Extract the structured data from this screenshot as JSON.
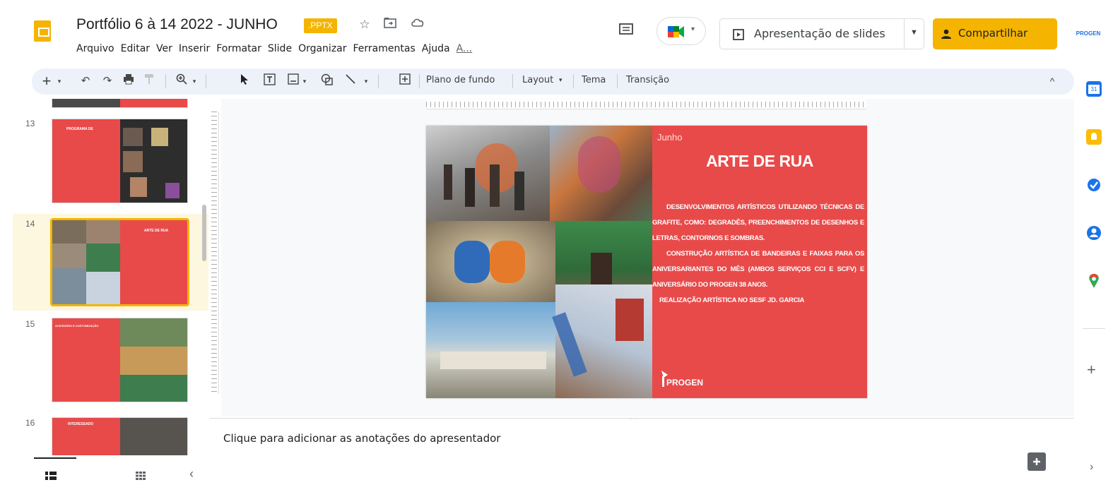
{
  "header": {
    "title": "Portfólio 6 à 14 2022 - JUNHO",
    "extension_badge": ".PPTX",
    "menu": [
      "Arquivo",
      "Editar",
      "Ver",
      "Inserir",
      "Formatar",
      "Slide",
      "Organizar",
      "Ferramentas",
      "Ajuda",
      "A..."
    ],
    "present_label": "Apresentação de slides",
    "share_label": "Compartilhar",
    "account_label": "PROGEN"
  },
  "toolbar": {
    "background_label": "Plano de fundo",
    "layout_label": "Layout",
    "theme_label": "Tema",
    "transition_label": "Transição"
  },
  "filmstrip": {
    "slides": [
      {
        "number": "13",
        "title": "PROGRAMA DE"
      },
      {
        "number": "14",
        "title": "ARTE DE RUA"
      },
      {
        "number": "15",
        "title": "ACESSÓRIO E CUSTOMIZAÇÃO"
      },
      {
        "number": "16",
        "title": "INTERESSADO"
      }
    ]
  },
  "slide": {
    "month": "Junho",
    "title": "ARTE DE RUA",
    "paragraphs": [
      "DESENVOLVIMENTOS ARTÍSTICOS UTILIZANDO TÉCNICAS DE GRAFITE, COMO: DEGRADÊS, PREENCHIMENTOS DE DESENHOS E LETRAS, CONTORNOS E SOMBRAS.",
      "CONSTRUÇÃO ARTÍSTICA DE BANDEIRAS E FAIXAS PARA OS ANIVERSARIANTES DO MÊS (AMBOS SERVIÇOS CCI E SCFV) E ANIVERSÁRIO DO PROGEN 38 ANOS.",
      "REALIZAÇÃO ARTÍSTICA NO SESF JD. GARCIA"
    ],
    "brand": "PROGEN"
  },
  "notes": {
    "placeholder": "Clique para adicionar as anotações do apresentador"
  },
  "colors": {
    "accent": "#f4b400",
    "slide_red": "#e84a4a"
  }
}
